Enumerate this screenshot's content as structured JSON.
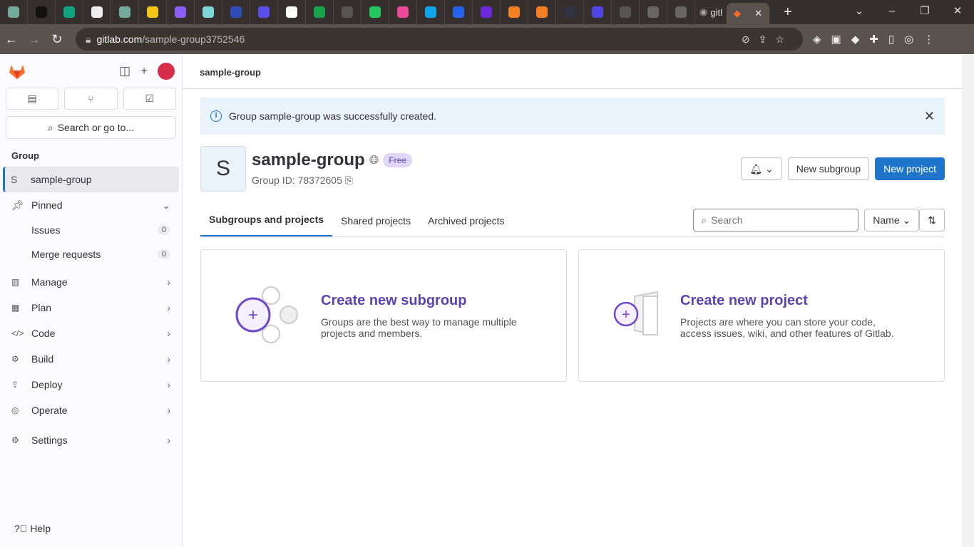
{
  "browser": {
    "tab_favicon_colors": [
      "#74aa9c",
      "#111",
      "#10a37f",
      "#eee",
      "#74aa9c",
      "#f5c518",
      "#8b5cf6",
      "#7fd6d6",
      "#2b4db5",
      "#5b4fe9",
      "#fff",
      "#16a34a",
      "#555",
      "#22c55e",
      "#ec4899",
      "#0ea5e9",
      "#2563eb",
      "#6d28d9",
      "#f48024",
      "#f48024",
      "#334",
      "#4f46e5",
      "#555",
      "#666",
      "#666"
    ],
    "active_tab_title": "gitl",
    "url_host": "gitlab.com",
    "url_path": "/sample-group3752546"
  },
  "sidebar": {
    "search": "Search or go to...",
    "section": "Group",
    "group_initial": "S",
    "group_name": "sample-group",
    "pinned": "Pinned",
    "issues": "Issues",
    "issues_count": "0",
    "mrs": "Merge requests",
    "mrs_count": "0",
    "items": [
      "Manage",
      "Plan",
      "Code",
      "Build",
      "Deploy",
      "Operate",
      "Settings"
    ],
    "help": "Help"
  },
  "main": {
    "breadcrumb": "sample-group",
    "alert": "Group sample-group was successfully created.",
    "group_initial": "S",
    "group_name": "sample-group",
    "badge": "Free",
    "group_id": "Group ID: 78372605",
    "new_subgroup": "New subgroup",
    "new_project": "New project",
    "tabs": [
      "Subgroups and projects",
      "Shared projects",
      "Archived projects"
    ],
    "search_placeholder": "Search",
    "sort": "Name",
    "cards": [
      {
        "title": "Create new subgroup",
        "desc": "Groups are the best way to manage multiple projects and members."
      },
      {
        "title": "Create new project",
        "desc": "Projects are where you can store your code, access issues, wiki, and other features of Gitlab."
      }
    ]
  }
}
